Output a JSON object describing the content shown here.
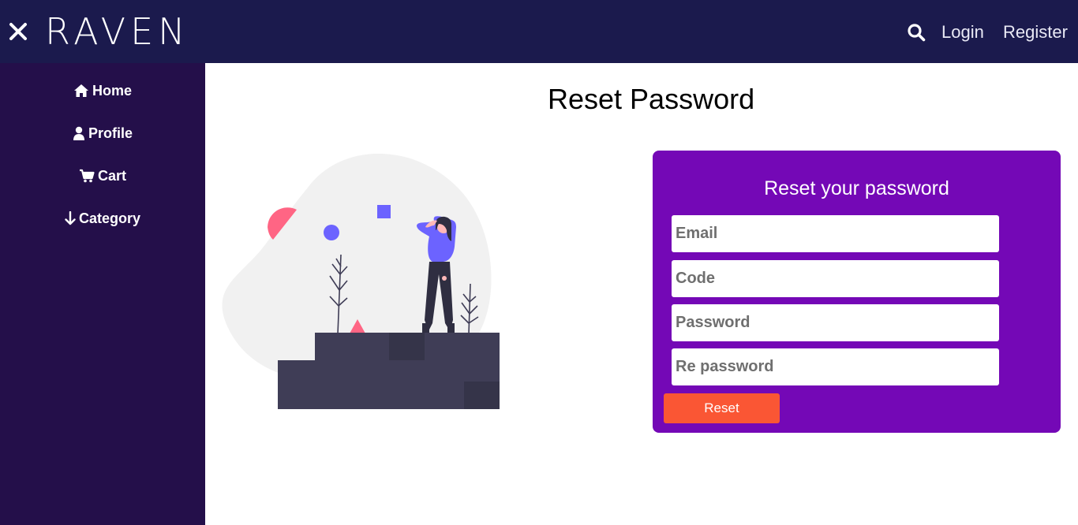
{
  "header": {
    "brand": "RAVEN",
    "close_icon": "close-icon",
    "search_icon": "search-icon",
    "login_label": "Login",
    "register_label": "Register",
    "background": "#1b1a4d"
  },
  "sidebar": {
    "background": "#240f4a",
    "items": [
      {
        "label": "Home",
        "icon": "home-icon"
      },
      {
        "label": "Profile",
        "icon": "user-icon"
      },
      {
        "label": "Cart",
        "icon": "cart-icon"
      },
      {
        "label": "Category",
        "icon": "arrow-down-icon"
      }
    ]
  },
  "main": {
    "title": "Reset Password"
  },
  "form": {
    "title": "Reset your password",
    "email_placeholder": "Email",
    "code_placeholder": "Code",
    "password_placeholder": "Password",
    "repassword_placeholder": "Re password",
    "reset_label": "Reset",
    "card_color": "#7408b6",
    "button_color": "#fa5634"
  }
}
